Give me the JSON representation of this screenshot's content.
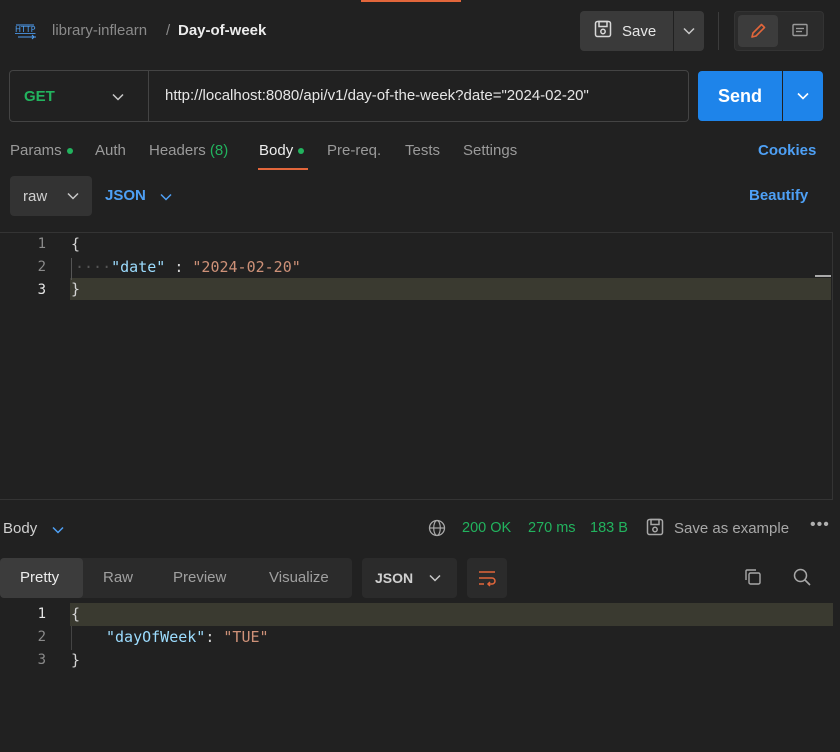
{
  "header": {
    "breadcrumb_parent": "library-inflearn",
    "breadcrumb_separator": "/",
    "breadcrumb_current": "Day-of-week",
    "save_label": "Save"
  },
  "request": {
    "method": "GET",
    "url": "http://localhost:8080/api/v1/day-of-the-week?date=\"2024-02-20\"",
    "send_label": "Send"
  },
  "request_tabs": {
    "params": "Params",
    "auth": "Auth",
    "headers": "Headers",
    "headers_count": "(8)",
    "body": "Body",
    "prereq": "Pre-req.",
    "tests": "Tests",
    "settings": "Settings",
    "cookies": "Cookies"
  },
  "body_options": {
    "mode": "raw",
    "format": "JSON",
    "beautify": "Beautify"
  },
  "request_body": {
    "line_numbers": [
      "1",
      "2",
      "3"
    ],
    "open_brace": "{",
    "indent_dots": "····",
    "key": "\"date\"",
    "colon": " : ",
    "value": "\"2024-02-20\"",
    "close_brace": "}"
  },
  "response": {
    "section_label": "Body",
    "status": "200 OK",
    "time": "270 ms",
    "size": "183 B",
    "save_example": "Save as example",
    "more": "•••",
    "tabs": [
      "Pretty",
      "Raw",
      "Preview",
      "Visualize"
    ],
    "format": "JSON",
    "line_numbers": [
      "1",
      "2",
      "3"
    ],
    "open_brace": "{",
    "key": "\"dayOfWeek\"",
    "colon": ": ",
    "value": "\"TUE\"",
    "close_brace": "}"
  },
  "colors": {
    "accent_orange": "#e2663b",
    "send_blue": "#1e84ea",
    "link_blue": "#4ea0f5",
    "success_green": "#22b35e"
  }
}
